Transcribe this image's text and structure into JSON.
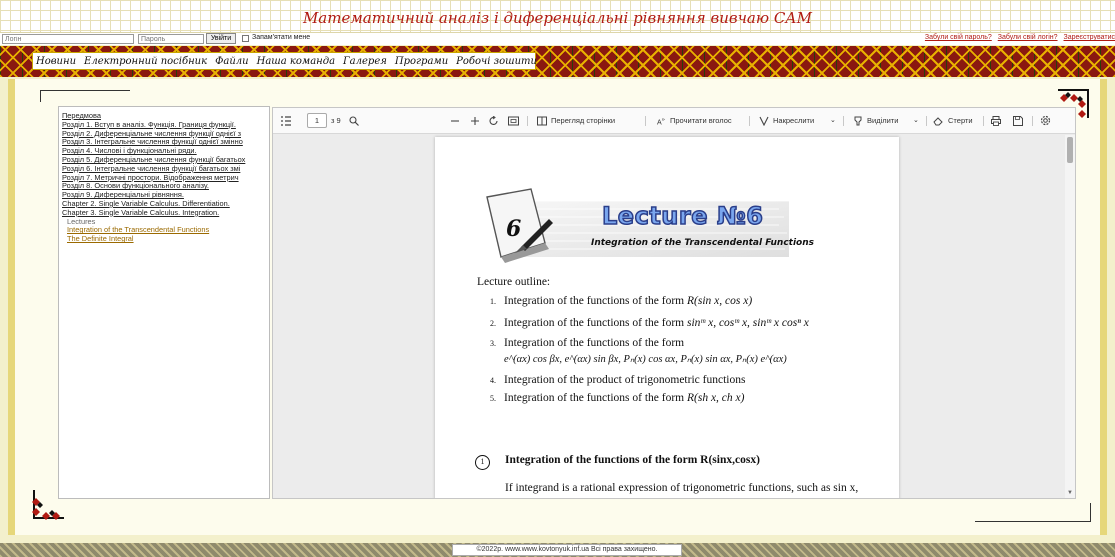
{
  "header": {
    "title": "Математичний аналіз і диференціальні рівняння вивчаю САМ"
  },
  "login": {
    "login_placeholder": "Логін",
    "password_placeholder": "Пароль",
    "submit_label": "Увійти",
    "remember_label": "Запам'ятати мене",
    "forgot_password": "Забули свій пароль?",
    "forgot_login": "Забули свій логін?",
    "register": "Зареєструватис"
  },
  "nav": {
    "items": [
      "Новини",
      "Електронний посібник",
      "Файли",
      "Наша команда",
      "Галерея",
      "Програми",
      "Робочі зошити"
    ]
  },
  "sidebar": {
    "items": [
      {
        "label": "Передмова",
        "type": "link"
      },
      {
        "label": "Розділ 1. Вступ в аналіз. Функція. Границя функції.",
        "type": "link"
      },
      {
        "label": "Розділ 2. Диференціальне числення функції однієї з",
        "type": "link"
      },
      {
        "label": "Розділ 3. Інтегральне числення функції однієї змінно",
        "type": "link"
      },
      {
        "label": "Розділ 4. Числові і функціональні ряди.",
        "type": "link"
      },
      {
        "label": "Розділ 5. Диференціальне числення функції багатьох",
        "type": "link"
      },
      {
        "label": "Розділ 6. Інтегральне числення функції багатьох змі",
        "type": "link"
      },
      {
        "label": "Розділ 7. Метричні простори. Відображення метрич",
        "type": "link"
      },
      {
        "label": "Розділ 8. Основи функціонального аналізу.",
        "type": "link"
      },
      {
        "label": "Розділ 9. Диференціальні рівняння.",
        "type": "link"
      },
      {
        "label": "Chapter 2. Single Variable Calculus. Differentiation.",
        "type": "link"
      },
      {
        "label": "Chapter 3. Single Variable Calculus. Integration.",
        "type": "link"
      },
      {
        "label": "Lectures",
        "type": "sub"
      },
      {
        "label": "Integration of the Transcendental Functions",
        "type": "sublink"
      },
      {
        "label": "The Definite Integral",
        "type": "sublink"
      }
    ]
  },
  "viewer": {
    "current_page": "1",
    "total_pages": "з 9",
    "page_view": "Перегляд сторінки",
    "read_aloud": "Прочитати вголос",
    "draw": "Накреслити",
    "highlight": "Виділити",
    "erase": "Стерти"
  },
  "lecture": {
    "number": "6",
    "title": "Lecture №6",
    "subtitle": "Integration of the Transcendental Functions",
    "outline_heading": "Lecture outline:",
    "outline": [
      {
        "num": "1.",
        "text": "Integration of the functions of the form ",
        "math": "R(sin x, cos x)"
      },
      {
        "num": "2.",
        "text": "Integration of the functions of the form ",
        "math": "sinᵐ x, cosᵐ x, sinᵐ x cosⁿ x"
      },
      {
        "num": "3.",
        "text": "Integration of the functions of the form",
        "math": ""
      },
      {
        "num": "",
        "text": "",
        "math": "e^(αx) cos βx, e^(αx) sin βx, Pₙ(x) cos αx, Pₙ(x) sin αx, Pₙ(x) e^(αx)"
      },
      {
        "num": "4.",
        "text": "Integration of the product of trigonometric functions",
        "math": ""
      },
      {
        "num": "5.",
        "text": "Integration of the functions of the form ",
        "math": "R(sh x, ch x)"
      }
    ],
    "section1_number": "1",
    "section1_heading": "Integration of the functions of the form R(sinx,cosx)",
    "section1_body": "If integrand is a rational expression of trigonometric functions, such as sin x,  cos x,  tg x,  ctg x,  sec x and cosec x, then it can be simplified to rational function of sin x and cos x:"
  },
  "footer": {
    "copyright": "©2022р. www.www.kovtonyuk.inf.ua Всі права захищено."
  },
  "icons": {
    "toc": "toc-icon",
    "search": "search-icon",
    "zoom_out": "minus-icon",
    "zoom_in": "plus-icon",
    "rotate": "rotate-icon",
    "fit": "fit-page-icon",
    "settings": "gear-icon"
  },
  "colors": {
    "title_red": "#b01a12",
    "ornament_red": "#8a1810",
    "ornament_gold": "#e8b100",
    "lecture_blue": "#7aa6ee"
  }
}
